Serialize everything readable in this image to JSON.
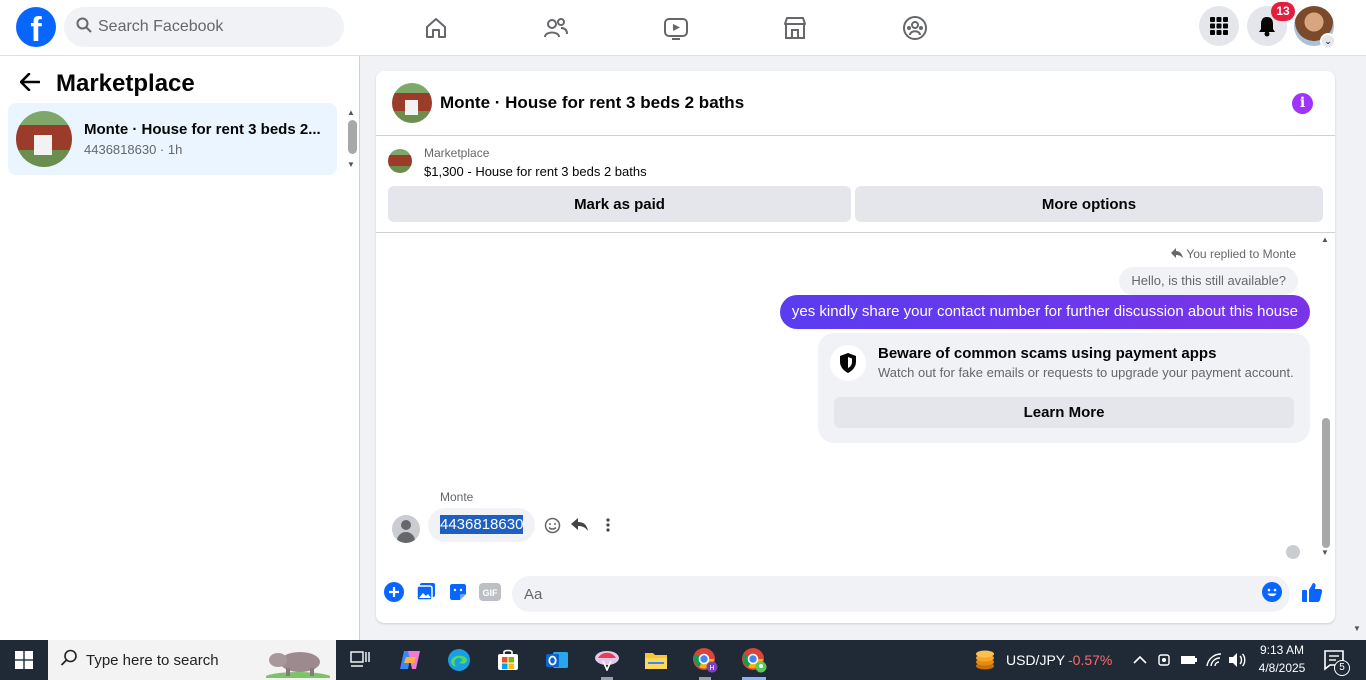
{
  "topbar": {
    "logo": "f",
    "search_placeholder": "Search Facebook",
    "nav_icons": [
      "home-icon",
      "friends-icon",
      "watch-icon",
      "marketplace-icon",
      "groups-icon"
    ],
    "notification_count": "13"
  },
  "sidebar": {
    "title": "Marketplace",
    "conversations": [
      {
        "title": "Monte · House for rent 3 beds 2...",
        "subtitle": "4436818630 · 1h"
      }
    ]
  },
  "chat": {
    "header_title": "Monte · House for rent 3 beds 2 baths",
    "listing": {
      "category": "Marketplace",
      "description": "$1,300 - House for rent 3 beds 2 baths"
    },
    "buttons": {
      "mark_paid": "Mark as paid",
      "more_options": "More options"
    },
    "replied_note": "You replied to Monte",
    "quoted_message": "Hello, is this still available?",
    "my_message": "yes kindly share your contact number for further discussion about this house",
    "scam_warning": {
      "title": "Beware of common scams using payment apps",
      "description": "Watch out for fake emails or requests to upgrade your payment account.",
      "button": "Learn More"
    },
    "sender_name": "Monte",
    "their_message": "4436818630",
    "composer_placeholder": "Aa"
  },
  "taskbar": {
    "search_placeholder": "Type here to search",
    "ticker_name": "USD/JPY",
    "ticker_change": "-0.57%",
    "time": "9:13 AM",
    "date": "4/8/2025",
    "notification_count": "5"
  },
  "colors": {
    "brand_blue": "#0866ff",
    "message_purple": "#6a40f2",
    "badge_red": "#e41e3f",
    "info_purple": "#a033ff"
  }
}
